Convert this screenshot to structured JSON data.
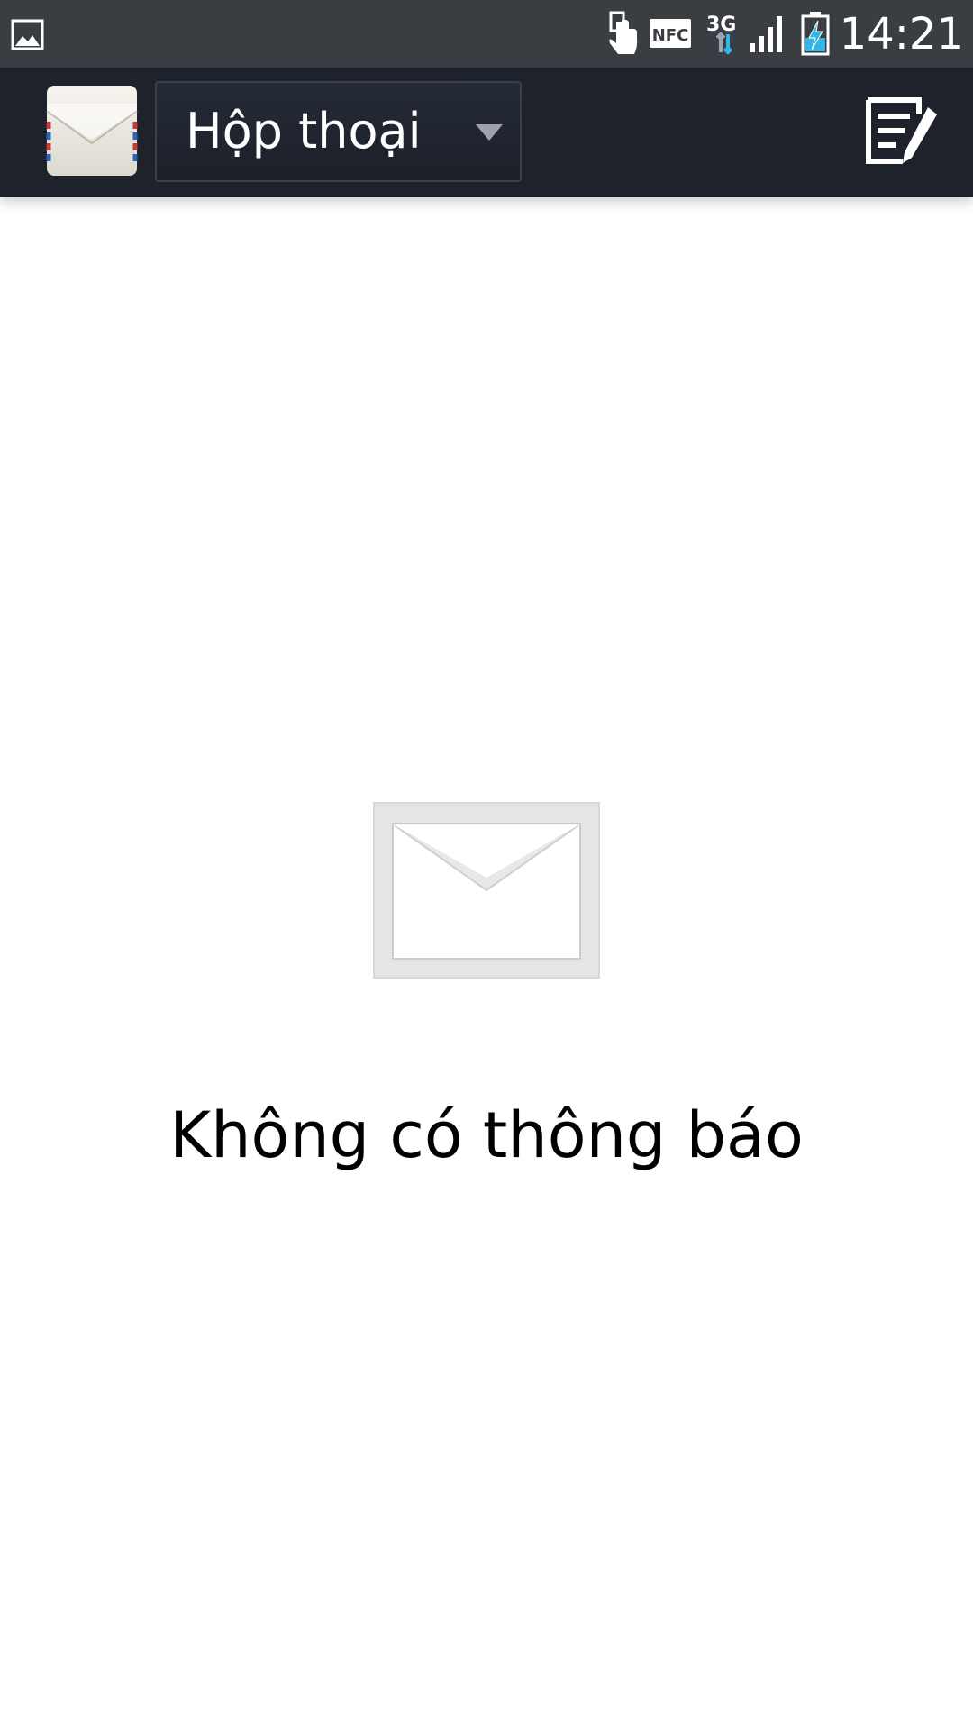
{
  "status_bar": {
    "time": "14:21",
    "left_icons": [
      "image-notification-icon"
    ],
    "right_icons": [
      "touch-icon",
      "nfc-icon",
      "network-3g-icon",
      "signal-icon",
      "battery-charging-icon"
    ],
    "nfc_label": "NFC",
    "network_label": "3G",
    "background_color": "#3a3d42"
  },
  "action_bar": {
    "app_icon": "envelope-app-icon",
    "spinner_label": "Hộp thoại",
    "compose_icon": "compose-icon",
    "background_color": "#1d222b"
  },
  "empty_state": {
    "icon": "envelope-placeholder-icon",
    "message": "Không có thông báo"
  }
}
